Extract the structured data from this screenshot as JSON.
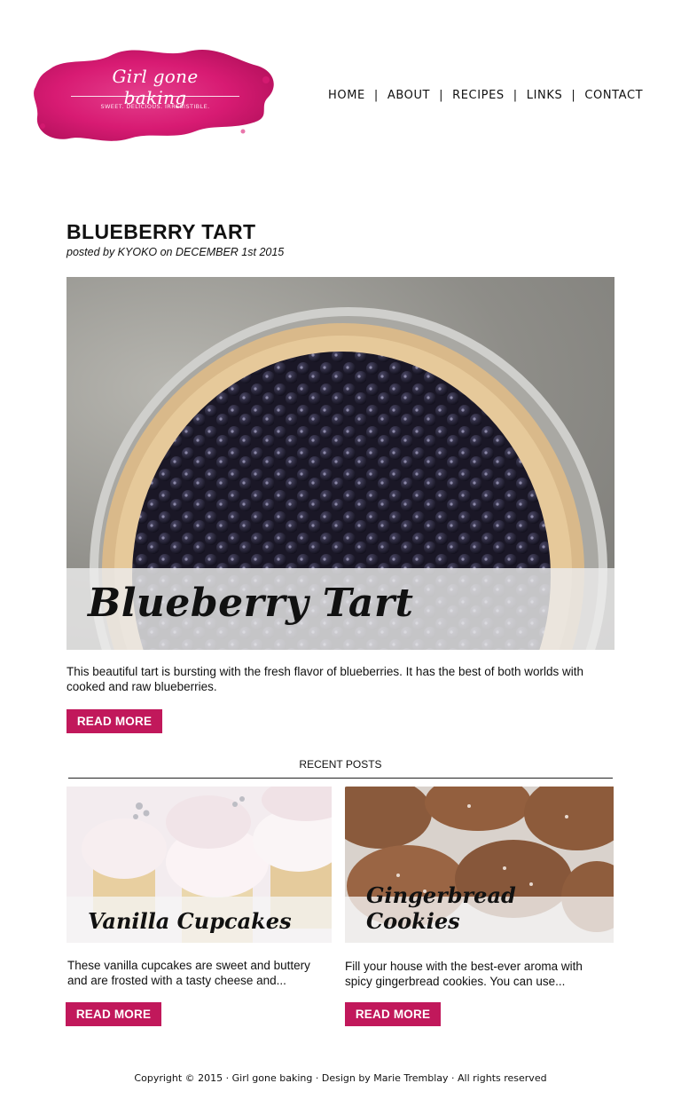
{
  "site": {
    "logo_title": "Girl gone baking",
    "logo_tagline": "SWEET. DELICIOUS. IRRESISTIBLE."
  },
  "nav": {
    "items": [
      "HOME",
      "ABOUT",
      "RECIPES",
      "LINKS",
      "CONTACT"
    ],
    "separator": "|"
  },
  "post": {
    "title": "BLUEBERRY TART",
    "meta": "posted by KYOKO on DECEMBER 1st 2015",
    "image_caption": "Blueberry Tart",
    "excerpt": "This beautiful tart is bursting with the fresh flavor of blueberries. It has the best of both worlds with cooked and raw blueberries.",
    "read_more": "READ MORE"
  },
  "recent": {
    "heading": "RECENT POSTS",
    "posts": [
      {
        "caption": "Vanilla Cupcakes",
        "excerpt": "These vanilla cupcakes are sweet and buttery and are frosted with a tasty cheese and...",
        "read_more": "READ MORE"
      },
      {
        "caption": "Gingerbread Cookies",
        "excerpt": "Fill your house with the best-ever aroma with spicy gingerbread cookies. You can use...",
        "read_more": "READ MORE"
      }
    ]
  },
  "footer": {
    "text": "Copyright © 2015 · Girl gone baking · Design by Marie Tremblay · All rights reserved"
  },
  "colors": {
    "accent": "#c1185b",
    "logo_pink": "#d81b73",
    "text": "#111111"
  }
}
